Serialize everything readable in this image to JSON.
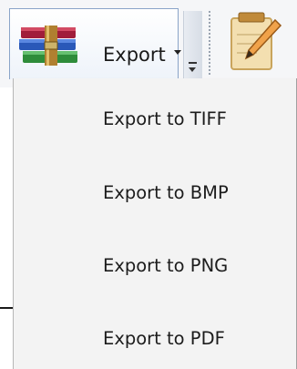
{
  "toolbar": {
    "export_button": {
      "label": "Export",
      "icon": "winrar-archive-icon"
    },
    "overflow_icon": "toolbar-overflow-chevron-icon",
    "notepad_icon": "notepad-pencil-icon"
  },
  "dropdown": {
    "items": [
      {
        "label": "Export to TIFF"
      },
      {
        "label": "Export to BMP"
      },
      {
        "label": "Export to PNG"
      },
      {
        "label": "Export to PDF"
      }
    ]
  },
  "colors": {
    "button_border": "#8aa4c8",
    "menu_background": "#f3f3f3",
    "menu_text": "#1c1c1c"
  }
}
